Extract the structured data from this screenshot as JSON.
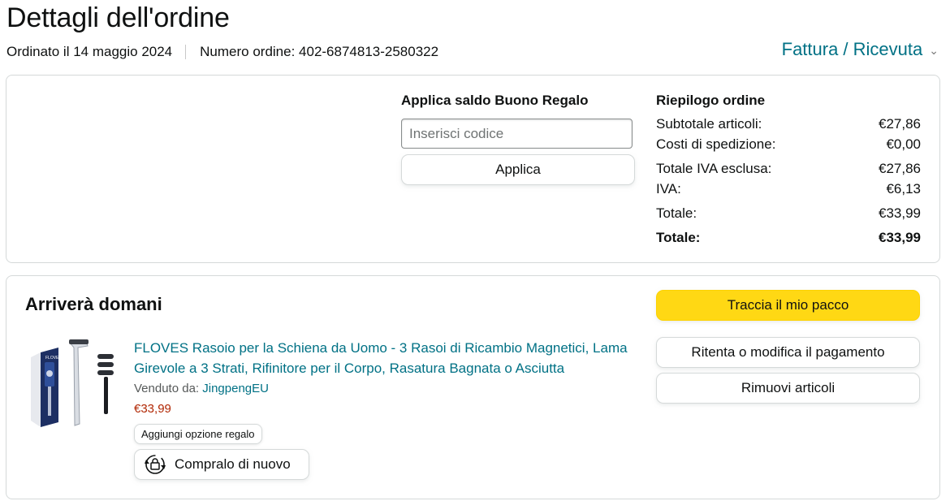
{
  "header": {
    "title": "Dettagli dell'ordine",
    "ordered_on": "Ordinato il 14 maggio 2024",
    "order_number": "Numero ordine: 402-6874813-2580322",
    "invoice_link": "Fattura / Ricevuta"
  },
  "gift_card": {
    "title": "Applica saldo Buono Regalo",
    "placeholder": "Inserisci codice",
    "value": "",
    "apply_label": "Applica"
  },
  "summary": {
    "title": "Riepilogo ordine",
    "rows": [
      {
        "label": "Subtotale articoli:",
        "value": "€27,86"
      },
      {
        "label": "Costi di spedizione:",
        "value": "€0,00"
      },
      {
        "label": "Totale IVA esclusa:",
        "value": "€27,86"
      },
      {
        "label": "IVA:",
        "value": "€6,13"
      },
      {
        "label": "Totale:",
        "value": "€33,99"
      },
      {
        "label": "Totale:",
        "value": "€33,99"
      }
    ]
  },
  "shipment": {
    "status": "Arriverà domani",
    "product_title": "FLOVES Rasoio per la Schiena da Uomo - 3 Rasoi di Ricambio Magnetici, Lama Girevole a 3 Strati, Rifinitore per il Corpo, Rasatura Bagnata o Asciutta",
    "sold_by_label": "Venduto da:",
    "seller": "JingpengEU",
    "price": "€33,99",
    "gift_option_label": "Aggiungi opzione regalo",
    "buy_again_label": "Compralo di nuovo",
    "buy_again_icon": "buy-again-icon"
  },
  "actions": {
    "track_label": "Traccia il mio pacco",
    "retry_payment_label": "Ritenta o modifica il pagamento",
    "remove_items_label": "Rimuovi articoli"
  },
  "colors": {
    "link": "#007185",
    "price": "#b12704",
    "primary_button": "#ffd814",
    "border": "#d5d9d9"
  }
}
